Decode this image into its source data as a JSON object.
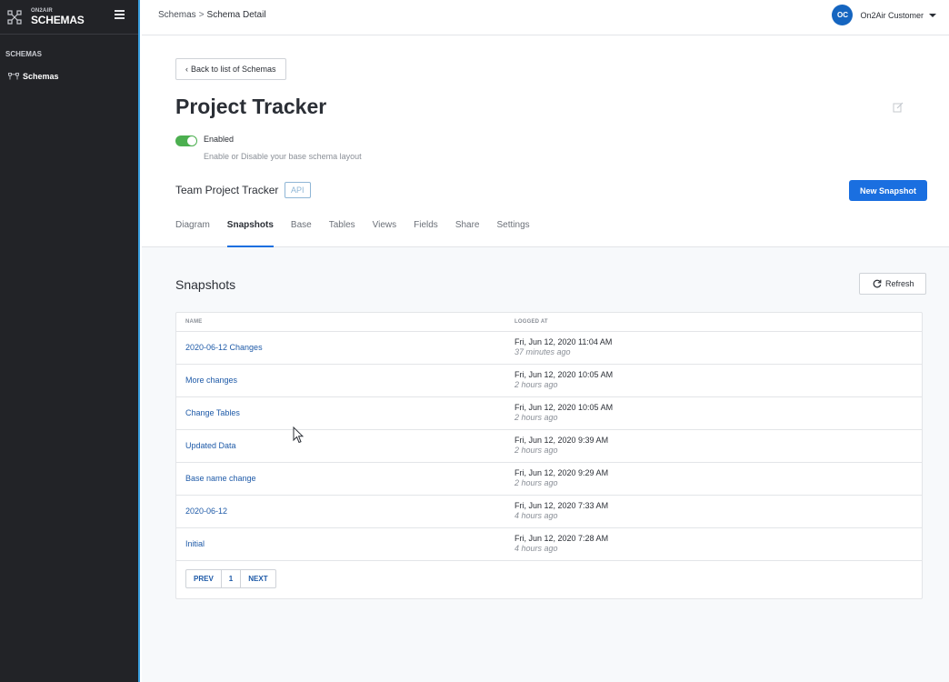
{
  "brand": {
    "small": "ON2AIR",
    "big": "SCHEMAS"
  },
  "sidebar": {
    "heading": "SCHEMAS",
    "items": [
      {
        "label": "Schemas",
        "icon": "schema-icon"
      }
    ]
  },
  "topbar": {
    "breadcrumb": {
      "parent": "Schemas",
      "separator": ">",
      "current": "Schema Detail"
    },
    "user": {
      "initials": "OC",
      "name": "On2Air Customer"
    }
  },
  "header": {
    "back_label": "Back to list of Schemas",
    "title": "Project Tracker",
    "toggle_label": "Enabled",
    "toggle_state": true,
    "toggle_help": "Enable or Disable your base schema layout",
    "base_name": "Team Project Tracker",
    "badge": "API",
    "new_snapshot_label": "New Snapshot",
    "tabs": [
      "Diagram",
      "Snapshots",
      "Base",
      "Tables",
      "Views",
      "Fields",
      "Share",
      "Settings"
    ],
    "active_tab": "Snapshots"
  },
  "snapshots": {
    "title": "Snapshots",
    "refresh_label": "Refresh",
    "columns": [
      "NAME",
      "LOGGED AT"
    ],
    "rows": [
      {
        "name": "2020-06-12 Changes",
        "logged": "Fri, Jun 12, 2020 11:04 AM",
        "ago": "37 minutes ago"
      },
      {
        "name": "More changes",
        "logged": "Fri, Jun 12, 2020 10:05 AM",
        "ago": "2 hours ago"
      },
      {
        "name": "Change Tables",
        "logged": "Fri, Jun 12, 2020 10:05 AM",
        "ago": "2 hours ago"
      },
      {
        "name": "Updated Data",
        "logged": "Fri, Jun 12, 2020 9:39 AM",
        "ago": "2 hours ago"
      },
      {
        "name": "Base name change",
        "logged": "Fri, Jun 12, 2020 9:29 AM",
        "ago": "2 hours ago"
      },
      {
        "name": "2020-06-12",
        "logged": "Fri, Jun 12, 2020 7:33 AM",
        "ago": "4 hours ago"
      },
      {
        "name": "Initial",
        "logged": "Fri, Jun 12, 2020 7:28 AM",
        "ago": "4 hours ago"
      }
    ],
    "pager": {
      "prev": "PREV",
      "page": "1",
      "next": "NEXT"
    }
  },
  "colors": {
    "accent": "#1a6fe0",
    "sidebar_bg": "#222327",
    "toggle_on": "#4caf50",
    "link": "#1e5aa8"
  }
}
